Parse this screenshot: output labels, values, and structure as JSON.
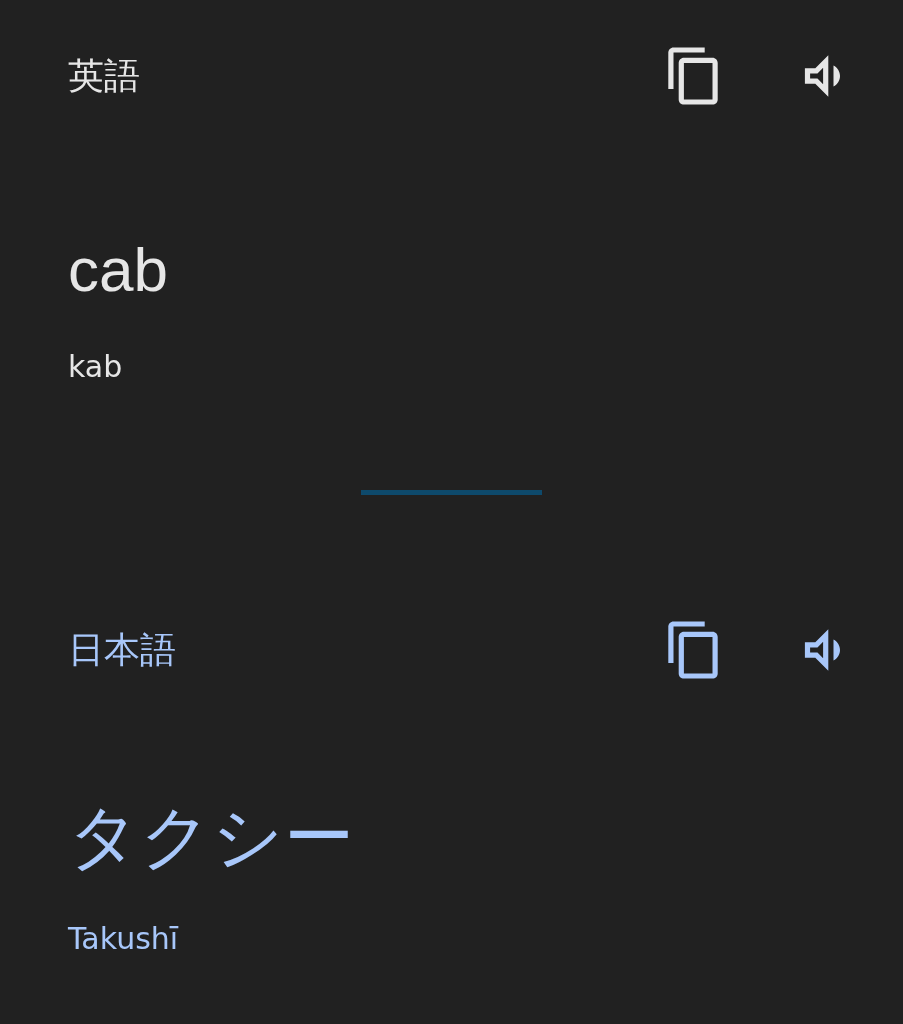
{
  "panels": [
    {
      "kind": "source",
      "language": "英語",
      "text": "cab",
      "romanization": "kab"
    },
    {
      "kind": "target",
      "language": "日本語",
      "text": "タクシー",
      "romanization": "Takushī"
    }
  ]
}
